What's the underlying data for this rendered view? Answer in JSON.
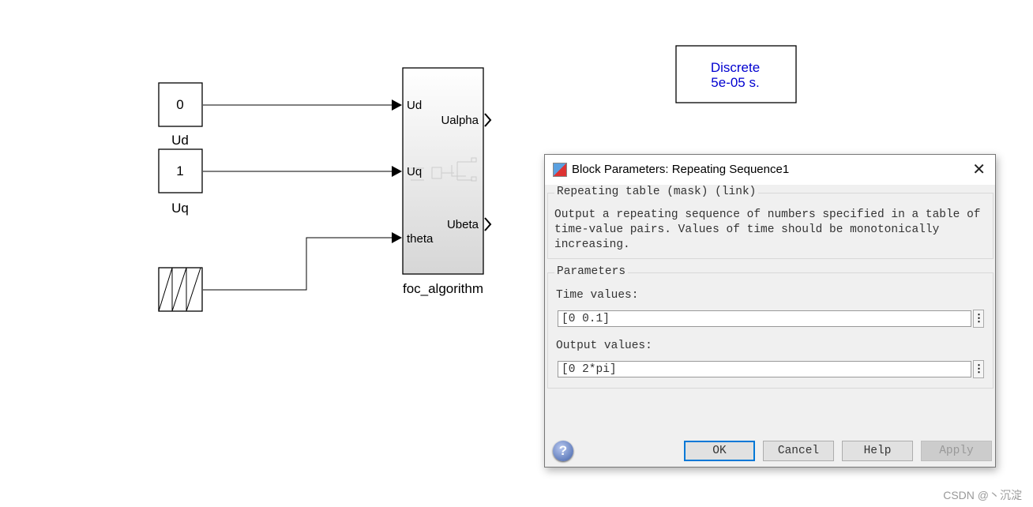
{
  "diagram": {
    "const_ud": {
      "value": "0",
      "label": "Ud"
    },
    "const_uq": {
      "value": "1",
      "label": "Uq"
    },
    "subsystem": {
      "name": "foc_algorithm",
      "inputs": [
        "Ud",
        "Uq",
        "theta"
      ],
      "outputs": [
        "Ualpha",
        "Ubeta"
      ]
    },
    "powergui": {
      "line1": "Discrete",
      "line2": "5e-05 s."
    }
  },
  "dialog": {
    "title": "Block Parameters: Repeating Sequence1",
    "group_title": "Repeating table (mask) (link)",
    "description": [
      "Output a repeating sequence of numbers specified in a table of",
      "time-value pairs. Values of time should be monotonically",
      "increasing."
    ],
    "params_title": "Parameters",
    "time_label": "Time values:",
    "time_value": "[0 0.1]",
    "output_label": "Output values:",
    "output_value": "[0 2*pi]",
    "buttons": {
      "ok": "OK",
      "cancel": "Cancel",
      "help": "Help",
      "apply": "Apply"
    }
  },
  "watermark": "CSDN @丶沉淀"
}
